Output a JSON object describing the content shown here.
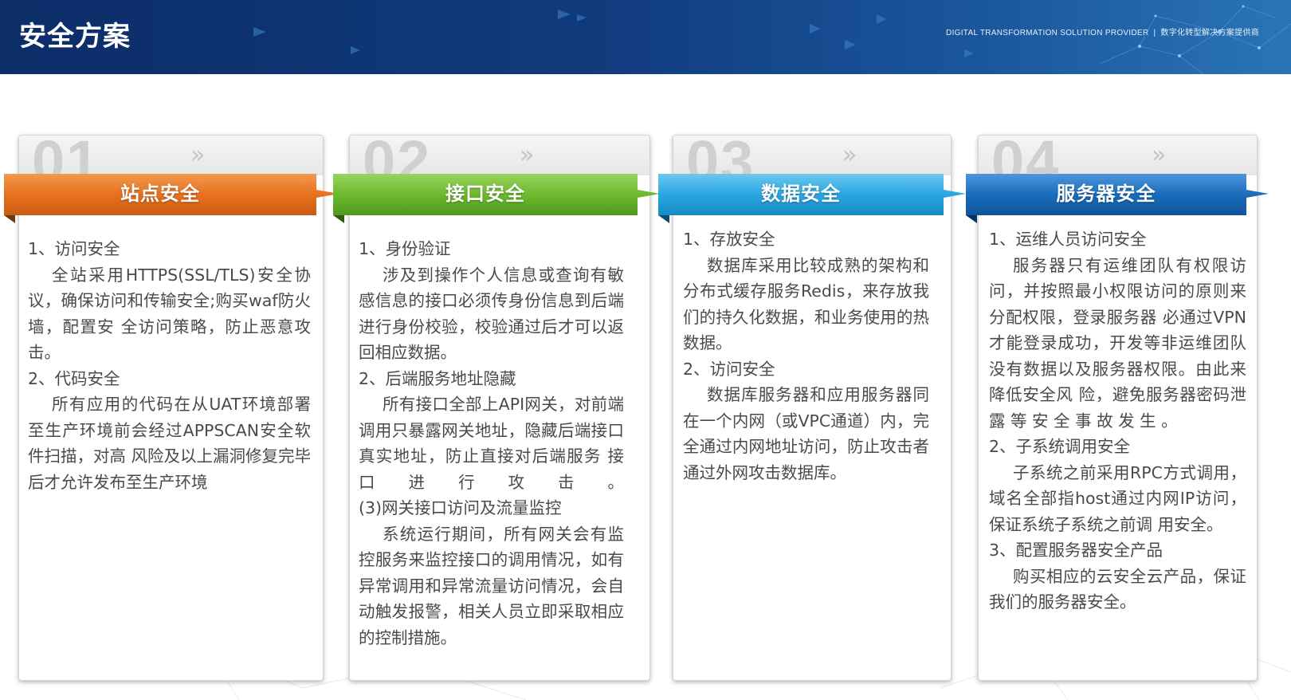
{
  "header": {
    "title": "安全方案",
    "tagline_en": "DIGITAL TRANSFORMATION SOLUTION PROVIDER",
    "tagline_sep": "|",
    "tagline_cn": "数字化转型解决方案提供商"
  },
  "cards": [
    {
      "number": "01",
      "chevron": "»",
      "title": "站点安全",
      "color": "#e8711e",
      "items": [
        {
          "heading": "1、访问安全",
          "text": "全站采用HTTPS(SSL/TLS)安全协议，确保访问和传输安全;购买waf防火墙，配置安 全访问策略，防止恶意攻击。"
        },
        {
          "heading": "2、代码安全",
          "text": "所有应用的代码在从UAT环境部署至生产环境前会经过APPSCAN安全软件扫描，对高 风险及以上漏洞修复完毕后才允许发布至生产环境"
        }
      ]
    },
    {
      "number": "02",
      "chevron": "»",
      "title": "接口安全",
      "color": "#6cba2d",
      "items": [
        {
          "heading": "1、身份验证",
          "text": "涉及到操作个人信息或查询有敏感信息的接口必须传身份信息到后端进行身份校验，校验通过后才可以返回相应数据。"
        },
        {
          "heading": "2、后端服务地址隐藏",
          "text": "所有接口全部上API网关，对前端调用只暴露网关地址，隐藏后端接口真实地址，防止直接对后端服务 接 口 进 行 攻 击 。"
        },
        {
          "heading": "(3)网关接口访问及流量监控",
          "text": "系统运行期间，所有网关会有监控服务来监控接口的调用情况，如有异常调用和异常流量访问情况，会自动触发报警，相关人员立即采取相应的控制措施。"
        }
      ]
    },
    {
      "number": "03",
      "chevron": "»",
      "title": "数据安全",
      "color": "#29a7e1",
      "items": [
        {
          "heading": "1、存放安全",
          "text": "数据库采用比较成熟的架构和分布式缓存服务Redis，来存放我们的持久化数据，和业务使用的热数据。"
        },
        {
          "heading": "2、访问安全",
          "text": "数据库服务器和应用服务器同在一个内网（或VPC通道）内，完全通过内网地址访问，防止攻击者通过外网攻击数据库。"
        }
      ]
    },
    {
      "number": "04",
      "chevron": "»",
      "title": "服务器安全",
      "color": "#1a6dbc",
      "items": [
        {
          "heading": "1、运维人员访问安全",
          "text": "服务器只有运维团队有权限访问，并按照最小权限访问的原则来分配权限，登录服务器 必通过VPN才能登录成功，开发等非运维团队没有数据以及服务器权限。由此来降低安全风 险，避免服务器密码泄 露 等 安 全 事 故 发 生 。"
        },
        {
          "heading": "2、子系统调用安全",
          "text": "子系统之前采用RPC方式调用，域名全部指host通过内网IP访问，保证系统子系统之前调 用安全。"
        },
        {
          "heading": "3、配置服务器安全产品",
          "text": "购买相应的云安全云产品，保证我们的服务器安全。"
        }
      ]
    }
  ]
}
